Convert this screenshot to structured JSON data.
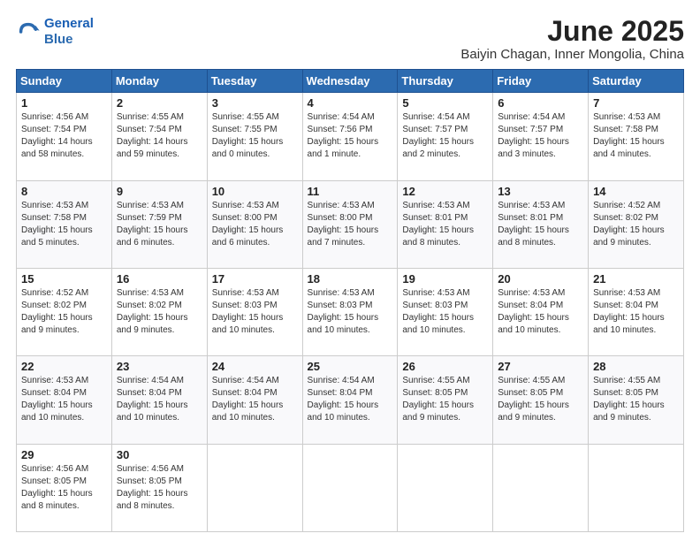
{
  "header": {
    "logo_line1": "General",
    "logo_line2": "Blue",
    "title": "June 2025",
    "subtitle": "Baiyin Chagan, Inner Mongolia, China"
  },
  "days_of_week": [
    "Sunday",
    "Monday",
    "Tuesday",
    "Wednesday",
    "Thursday",
    "Friday",
    "Saturday"
  ],
  "weeks": [
    [
      {
        "day": "1",
        "text": "Sunrise: 4:56 AM\nSunset: 7:54 PM\nDaylight: 14 hours\nand 58 minutes."
      },
      {
        "day": "2",
        "text": "Sunrise: 4:55 AM\nSunset: 7:54 PM\nDaylight: 14 hours\nand 59 minutes."
      },
      {
        "day": "3",
        "text": "Sunrise: 4:55 AM\nSunset: 7:55 PM\nDaylight: 15 hours\nand 0 minutes."
      },
      {
        "day": "4",
        "text": "Sunrise: 4:54 AM\nSunset: 7:56 PM\nDaylight: 15 hours\nand 1 minute."
      },
      {
        "day": "5",
        "text": "Sunrise: 4:54 AM\nSunset: 7:57 PM\nDaylight: 15 hours\nand 2 minutes."
      },
      {
        "day": "6",
        "text": "Sunrise: 4:54 AM\nSunset: 7:57 PM\nDaylight: 15 hours\nand 3 minutes."
      },
      {
        "day": "7",
        "text": "Sunrise: 4:53 AM\nSunset: 7:58 PM\nDaylight: 15 hours\nand 4 minutes."
      }
    ],
    [
      {
        "day": "8",
        "text": "Sunrise: 4:53 AM\nSunset: 7:58 PM\nDaylight: 15 hours\nand 5 minutes."
      },
      {
        "day": "9",
        "text": "Sunrise: 4:53 AM\nSunset: 7:59 PM\nDaylight: 15 hours\nand 6 minutes."
      },
      {
        "day": "10",
        "text": "Sunrise: 4:53 AM\nSunset: 8:00 PM\nDaylight: 15 hours\nand 6 minutes."
      },
      {
        "day": "11",
        "text": "Sunrise: 4:53 AM\nSunset: 8:00 PM\nDaylight: 15 hours\nand 7 minutes."
      },
      {
        "day": "12",
        "text": "Sunrise: 4:53 AM\nSunset: 8:01 PM\nDaylight: 15 hours\nand 8 minutes."
      },
      {
        "day": "13",
        "text": "Sunrise: 4:53 AM\nSunset: 8:01 PM\nDaylight: 15 hours\nand 8 minutes."
      },
      {
        "day": "14",
        "text": "Sunrise: 4:52 AM\nSunset: 8:02 PM\nDaylight: 15 hours\nand 9 minutes."
      }
    ],
    [
      {
        "day": "15",
        "text": "Sunrise: 4:52 AM\nSunset: 8:02 PM\nDaylight: 15 hours\nand 9 minutes."
      },
      {
        "day": "16",
        "text": "Sunrise: 4:53 AM\nSunset: 8:02 PM\nDaylight: 15 hours\nand 9 minutes."
      },
      {
        "day": "17",
        "text": "Sunrise: 4:53 AM\nSunset: 8:03 PM\nDaylight: 15 hours\nand 10 minutes."
      },
      {
        "day": "18",
        "text": "Sunrise: 4:53 AM\nSunset: 8:03 PM\nDaylight: 15 hours\nand 10 minutes."
      },
      {
        "day": "19",
        "text": "Sunrise: 4:53 AM\nSunset: 8:03 PM\nDaylight: 15 hours\nand 10 minutes."
      },
      {
        "day": "20",
        "text": "Sunrise: 4:53 AM\nSunset: 8:04 PM\nDaylight: 15 hours\nand 10 minutes."
      },
      {
        "day": "21",
        "text": "Sunrise: 4:53 AM\nSunset: 8:04 PM\nDaylight: 15 hours\nand 10 minutes."
      }
    ],
    [
      {
        "day": "22",
        "text": "Sunrise: 4:53 AM\nSunset: 8:04 PM\nDaylight: 15 hours\nand 10 minutes."
      },
      {
        "day": "23",
        "text": "Sunrise: 4:54 AM\nSunset: 8:04 PM\nDaylight: 15 hours\nand 10 minutes."
      },
      {
        "day": "24",
        "text": "Sunrise: 4:54 AM\nSunset: 8:04 PM\nDaylight: 15 hours\nand 10 minutes."
      },
      {
        "day": "25",
        "text": "Sunrise: 4:54 AM\nSunset: 8:04 PM\nDaylight: 15 hours\nand 10 minutes."
      },
      {
        "day": "26",
        "text": "Sunrise: 4:55 AM\nSunset: 8:05 PM\nDaylight: 15 hours\nand 9 minutes."
      },
      {
        "day": "27",
        "text": "Sunrise: 4:55 AM\nSunset: 8:05 PM\nDaylight: 15 hours\nand 9 minutes."
      },
      {
        "day": "28",
        "text": "Sunrise: 4:55 AM\nSunset: 8:05 PM\nDaylight: 15 hours\nand 9 minutes."
      }
    ],
    [
      {
        "day": "29",
        "text": "Sunrise: 4:56 AM\nSunset: 8:05 PM\nDaylight: 15 hours\nand 8 minutes."
      },
      {
        "day": "30",
        "text": "Sunrise: 4:56 AM\nSunset: 8:05 PM\nDaylight: 15 hours\nand 8 minutes."
      },
      {
        "day": "",
        "text": ""
      },
      {
        "day": "",
        "text": ""
      },
      {
        "day": "",
        "text": ""
      },
      {
        "day": "",
        "text": ""
      },
      {
        "day": "",
        "text": ""
      }
    ]
  ]
}
